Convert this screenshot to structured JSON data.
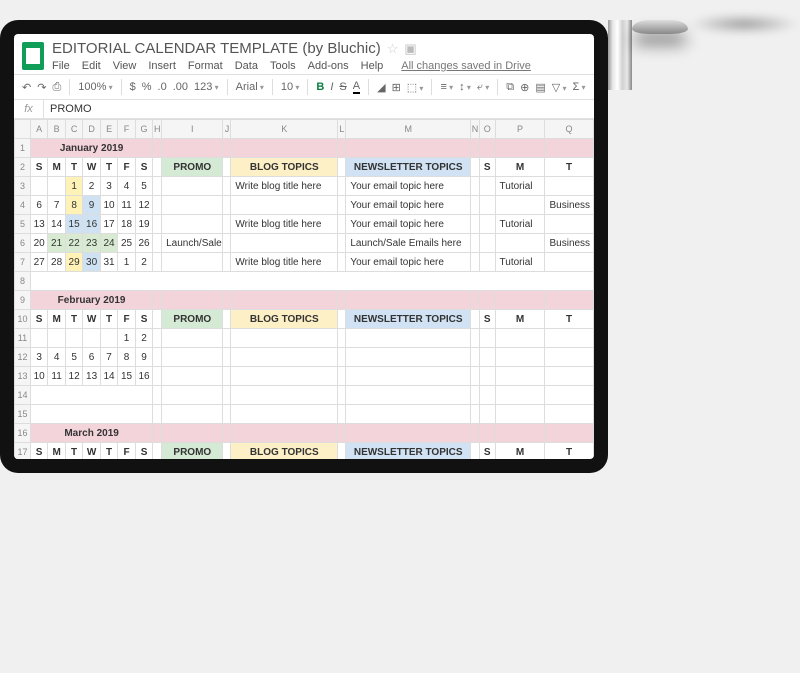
{
  "doc_title": "EDITORIAL CALENDAR TEMPLATE (by Bluchic)",
  "saved": "All changes saved in Drive",
  "menu": [
    "File",
    "Edit",
    "View",
    "Insert",
    "Format",
    "Data",
    "Tools",
    "Add-ons",
    "Help"
  ],
  "toolbar": {
    "zoom": "100%",
    "font": "Arial",
    "size": "10",
    "numfmt": ".0",
    "numfmt2": ".00",
    "numfmt3": "123"
  },
  "fx": "PROMO",
  "cols": [
    "A",
    "B",
    "C",
    "D",
    "E",
    "F",
    "G",
    "H",
    "I",
    "J",
    "K",
    "L",
    "M",
    "N",
    "O",
    "P",
    "Q"
  ],
  "day_headers": [
    "S",
    "M",
    "T",
    "W",
    "T",
    "F",
    "S"
  ],
  "sections": {
    "promo": "PROMO",
    "blog": "BLOG TOPICS",
    "news": "NEWSLETTER TOPICS",
    "s": "S",
    "m": "M",
    "t": "T"
  },
  "months": {
    "jan": {
      "title": "January 2019",
      "rows": [
        [
          "",
          "",
          "1",
          "2",
          "3",
          "4",
          "5"
        ],
        [
          "6",
          "7",
          "8",
          "9",
          "10",
          "11",
          "12"
        ],
        [
          "13",
          "14",
          "15",
          "16",
          "17",
          "18",
          "19"
        ],
        [
          "20",
          "21",
          "22",
          "23",
          "24",
          "25",
          "26"
        ],
        [
          "27",
          "28",
          "29",
          "30",
          "31",
          "1",
          "2"
        ]
      ]
    },
    "feb": {
      "title": "February 2019",
      "rows": [
        [
          "",
          "",
          "",
          "",
          "",
          "1",
          "2"
        ],
        [
          "3",
          "4",
          "5",
          "6",
          "7",
          "8",
          "9"
        ],
        [
          "10",
          "11",
          "12",
          "13",
          "14",
          "15",
          "16"
        ],
        [
          "",
          "",
          "",
          "",
          "",
          "",
          ""
        ],
        [
          "",
          "",
          "",
          "",
          "",
          "",
          ""
        ]
      ]
    },
    "mar": {
      "title": "March 2019"
    }
  },
  "content": {
    "blog1": "Write blog title here",
    "news1": "Your email topic here",
    "launch": "Launch/Sale",
    "launch_email": "Launch/Sale Emails here",
    "tutorial": "Tutorial",
    "business": "Business"
  }
}
